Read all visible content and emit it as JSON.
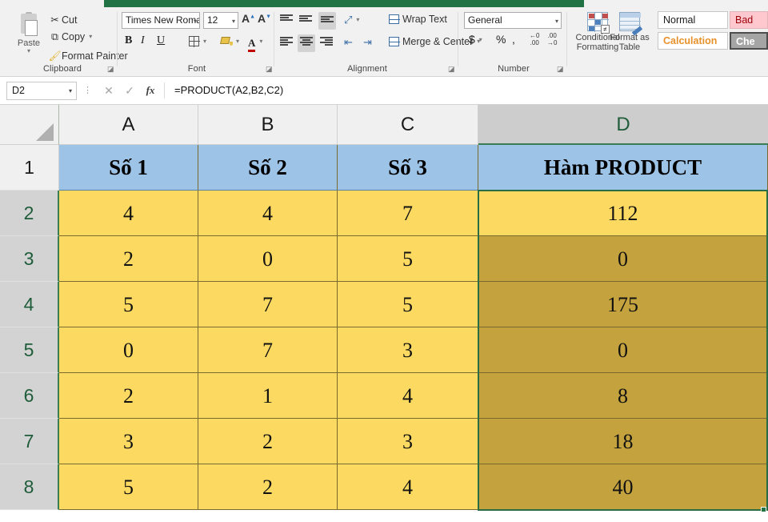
{
  "app": {
    "accent_green": "#217346"
  },
  "ribbon": {
    "clipboard": {
      "group_label": "Clipboard",
      "paste_label": "Paste",
      "cut_label": "Cut",
      "copy_label": "Copy",
      "format_painter_label": "Format Painter"
    },
    "font": {
      "group_label": "Font",
      "font_name": "Times New Roma",
      "font_size": "12",
      "bold_label": "B",
      "italic_label": "I",
      "underline_label": "U",
      "grow_font_label": "A",
      "shrink_font_label": "A"
    },
    "alignment": {
      "group_label": "Alignment",
      "wrap_text_label": "Wrap Text",
      "merge_center_label": "Merge & Center"
    },
    "number": {
      "group_label": "Number",
      "format_value": "General",
      "currency_label": "$",
      "percent_label": "%",
      "comma_label": ",",
      "increase_decimal_label": ".00",
      "decrease_decimal_label": ".00"
    },
    "styles": {
      "conditional_formatting_line1": "Conditional",
      "conditional_formatting_line2": "Formatting",
      "format_as_table_line1": "Format as",
      "format_as_table_line2": "Table",
      "style_normal": "Normal",
      "style_bad": "Bad",
      "style_calculation": "Calculation",
      "style_check_cell": "Che"
    }
  },
  "formula_bar": {
    "name_box": "D2",
    "cancel_icon": "✕",
    "confirm_icon": "✓",
    "fx_label": "fx",
    "formula": "=PRODUCT(A2,B2,C2)"
  },
  "sheet": {
    "column_headers": [
      "A",
      "B",
      "C",
      "D"
    ],
    "selected_column": "D",
    "row_headers": [
      "1",
      "2",
      "3",
      "4",
      "5",
      "6",
      "7",
      "8"
    ],
    "selected_rows": [
      "2",
      "3",
      "4",
      "5",
      "6",
      "7",
      "8"
    ],
    "header_row": [
      "Số 1",
      "Số 2",
      "Số 3",
      "Hàm PRODUCT"
    ],
    "rows": [
      {
        "row": "2",
        "a": "4",
        "b": "4",
        "c": "7",
        "d": "112"
      },
      {
        "row": "3",
        "a": "2",
        "b": "0",
        "c": "5",
        "d": "0"
      },
      {
        "row": "4",
        "a": "5",
        "b": "7",
        "c": "5",
        "d": "175"
      },
      {
        "row": "5",
        "a": "0",
        "b": "7",
        "c": "3",
        "d": "0"
      },
      {
        "row": "6",
        "a": "2",
        "b": "1",
        "c": "4",
        "d": "8"
      },
      {
        "row": "7",
        "a": "3",
        "b": "2",
        "c": "3",
        "d": "18"
      },
      {
        "row": "8",
        "a": "5",
        "b": "2",
        "c": "4",
        "d": "40"
      }
    ],
    "colors": {
      "header_fill": "#9dc3e6",
      "data_fill": "#fcd960",
      "selected_fill": "#c4a33e",
      "selection_border": "#2a6c43"
    }
  }
}
